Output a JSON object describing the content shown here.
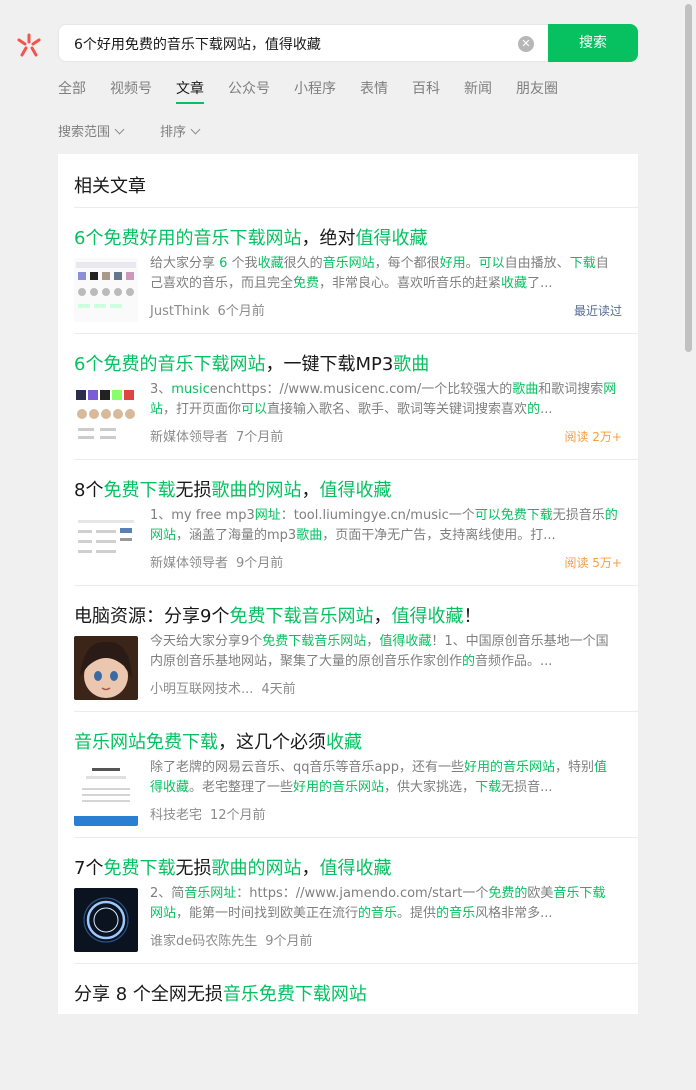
{
  "search": {
    "query": "6个好用免费的音乐下载网站，值得收藏",
    "button_label": "搜索"
  },
  "tabs": [
    "全部",
    "视频号",
    "文章",
    "公众号",
    "小程序",
    "表情",
    "百科",
    "新闻",
    "朋友圈"
  ],
  "active_tab": "文章",
  "filters": [
    "搜索范围",
    "排序"
  ],
  "card": {
    "title": "相关文章"
  },
  "colors": {
    "accent": "#07c160",
    "link": "#576b95",
    "read": "#fa9d3b"
  },
  "articles": [
    {
      "title": [
        [
          "h",
          "6个免费好用的音乐下载网站"
        ],
        [
          "n",
          "，绝对"
        ],
        [
          "h",
          "值得收藏"
        ]
      ],
      "desc": [
        [
          "n",
          "给大家分享 "
        ],
        [
          "h",
          "6"
        ],
        [
          "n",
          " 个我"
        ],
        [
          "h",
          "收藏"
        ],
        [
          "n",
          "很久的"
        ],
        [
          "h",
          "音乐网站"
        ],
        [
          "n",
          "，每个都很"
        ],
        [
          "h",
          "好用"
        ],
        [
          "n",
          "。"
        ],
        [
          "h",
          "可以"
        ],
        [
          "n",
          "自由播放、"
        ],
        [
          "h",
          "下载"
        ],
        [
          "n",
          "自己喜欢的音乐，而且完全"
        ],
        [
          "h",
          "免费"
        ],
        [
          "n",
          "，非常良心。喜欢听音乐的赶紧"
        ],
        [
          "h",
          "收藏"
        ],
        [
          "n",
          "了..."
        ]
      ],
      "source": "JustThink",
      "time": "6个月前",
      "badge": "最近读过",
      "badge_type": "recent",
      "thumb": "grid"
    },
    {
      "title": [
        [
          "h",
          "6个免费的音乐下载网站"
        ],
        [
          "n",
          "，一键下载MP3"
        ],
        [
          "h",
          "歌曲"
        ]
      ],
      "desc": [
        [
          "n",
          "3、"
        ],
        [
          "h",
          "music"
        ],
        [
          "n",
          "enchttps：//www.musicenc.com/一个比较强大的"
        ],
        [
          "h",
          "歌曲"
        ],
        [
          "n",
          "和歌词搜索"
        ],
        [
          "h",
          "网站"
        ],
        [
          "n",
          "，打开页面你"
        ],
        [
          "h",
          "可以"
        ],
        [
          "n",
          "直接输入歌名、歌手、歌词等关键词搜索喜欢"
        ],
        [
          "h",
          "的"
        ],
        [
          "n",
          "..."
        ]
      ],
      "source": "新媒体领导者",
      "time": "7个月前",
      "badge": "阅读 2万+",
      "badge_type": "read",
      "thumb": "faces"
    },
    {
      "title": [
        [
          "n",
          "8个"
        ],
        [
          "h",
          "免费下载"
        ],
        [
          "n",
          "无损"
        ],
        [
          "h",
          "歌曲的网站"
        ],
        [
          "n",
          "，"
        ],
        [
          "h",
          "值得收藏"
        ]
      ],
      "desc": [
        [
          "n",
          "1、my free mp3"
        ],
        [
          "h",
          "网址"
        ],
        [
          "n",
          "：tool.liumingye.cn/music一个"
        ],
        [
          "h",
          "可以免费下载"
        ],
        [
          "n",
          "无损音乐"
        ],
        [
          "h",
          "的网站"
        ],
        [
          "n",
          "，涵盖了海量的mp3"
        ],
        [
          "h",
          "歌曲"
        ],
        [
          "n",
          "，页面干净无广告，支持离线使用。打..."
        ]
      ],
      "source": "新媒体领导者",
      "time": "9个月前",
      "badge": "阅读 5万+",
      "badge_type": "read",
      "thumb": "table"
    },
    {
      "title": [
        [
          "n",
          "电脑资源：分享9个"
        ],
        [
          "h",
          "免费下载音乐网站"
        ],
        [
          "n",
          "，"
        ],
        [
          "h",
          "值得收藏"
        ],
        [
          "n",
          "！"
        ]
      ],
      "desc": [
        [
          "n",
          "今天给大家分享9个"
        ],
        [
          "h",
          "免费下载音乐网站"
        ],
        [
          "n",
          "，"
        ],
        [
          "h",
          "值得收藏"
        ],
        [
          "n",
          "！1、中国原创音乐基地一个国内原创音乐基地网站，聚集了大量的原创音乐作家创作"
        ],
        [
          "h",
          "的"
        ],
        [
          "n",
          "音频作品。..."
        ]
      ],
      "source": "小明互联网技术...",
      "time": "4天前",
      "badge": "",
      "badge_type": "none",
      "thumb": "anime"
    },
    {
      "title": [
        [
          "h",
          "音乐网站免费下载"
        ],
        [
          "n",
          "，这几个必须"
        ],
        [
          "h",
          "收藏"
        ]
      ],
      "desc": [
        [
          "n",
          "除了老牌的网易云音乐、qq音乐等音乐app，还有一些"
        ],
        [
          "h",
          "好用的音乐网站"
        ],
        [
          "n",
          "，特别"
        ],
        [
          "h",
          "值得收藏"
        ],
        [
          "n",
          "。老宅整理了一些"
        ],
        [
          "h",
          "好用的音乐网站"
        ],
        [
          "n",
          "，供大家挑选，"
        ],
        [
          "h",
          "下载"
        ],
        [
          "n",
          "无损音..."
        ]
      ],
      "source": "科技老宅",
      "time": "12个月前",
      "badge": "",
      "badge_type": "none",
      "thumb": "site"
    },
    {
      "title": [
        [
          "n",
          "7个"
        ],
        [
          "h",
          "免费下载"
        ],
        [
          "n",
          "无损"
        ],
        [
          "h",
          "歌曲的网站"
        ],
        [
          "n",
          "，"
        ],
        [
          "h",
          "值得收藏"
        ]
      ],
      "desc": [
        [
          "n",
          "2、简"
        ],
        [
          "h",
          "音乐网址"
        ],
        [
          "n",
          "：https：//www.jamendo.com/start一个"
        ],
        [
          "h",
          "免费的"
        ],
        [
          "n",
          "欧美"
        ],
        [
          "h",
          "音乐下载网站"
        ],
        [
          "n",
          "，能第一时间找到欧美正在流行"
        ],
        [
          "h",
          "的音乐"
        ],
        [
          "n",
          "。提供"
        ],
        [
          "h",
          "的音乐"
        ],
        [
          "n",
          "风格非常多..."
        ]
      ],
      "source": "谁家de码农陈先生",
      "time": "9个月前",
      "badge": "",
      "badge_type": "none",
      "thumb": "ring"
    },
    {
      "title": [
        [
          "n",
          "分享 8 个全网无损"
        ],
        [
          "h",
          "音乐免费下载网站"
        ]
      ],
      "desc": [],
      "source": "",
      "time": "",
      "badge": "",
      "badge_type": "none",
      "thumb": "none"
    }
  ]
}
